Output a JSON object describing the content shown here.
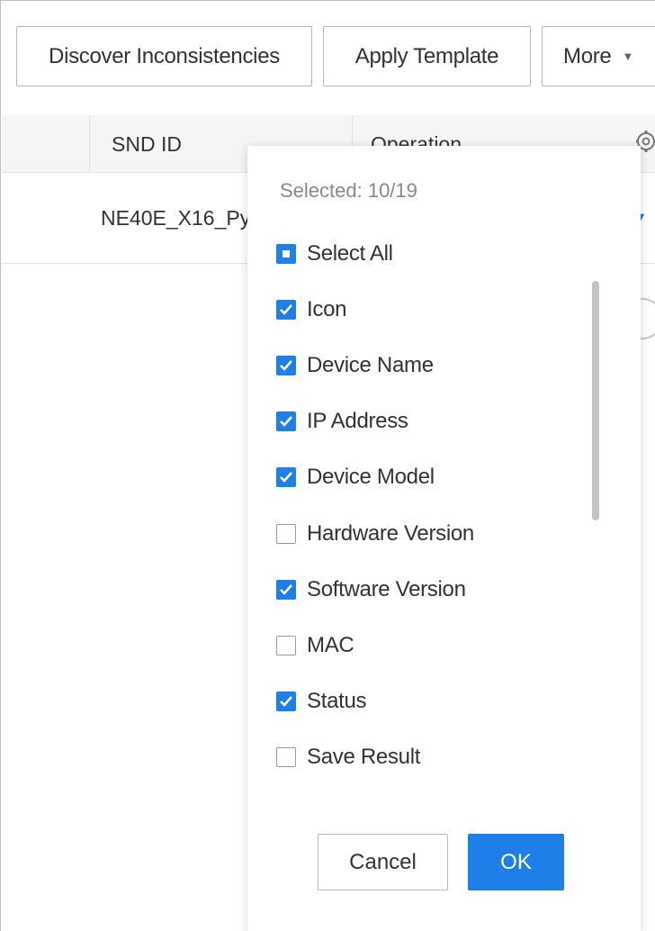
{
  "toolbar": {
    "discover_label": "Discover Inconsistencies",
    "apply_label": "Apply Template",
    "more_label": "More"
  },
  "table": {
    "columns": [
      "SND ID",
      "Operation"
    ],
    "rows": [
      {
        "snd_id": "NE40E_X16_Py"
      }
    ]
  },
  "column_picker": {
    "selected_text": "Selected: 10/19",
    "select_all_label": "Select All",
    "select_all_state": "partial",
    "options": [
      {
        "label": "Icon",
        "checked": true
      },
      {
        "label": "Device Name",
        "checked": true
      },
      {
        "label": "IP Address",
        "checked": true
      },
      {
        "label": "Device Model",
        "checked": true
      },
      {
        "label": "Hardware Version",
        "checked": false
      },
      {
        "label": "Software Version",
        "checked": true
      },
      {
        "label": "MAC",
        "checked": false
      },
      {
        "label": "Status",
        "checked": true
      },
      {
        "label": "Save Result",
        "checked": false
      }
    ],
    "cancel_label": "Cancel",
    "ok_label": "OK"
  },
  "colors": {
    "accent": "#1e7fe8",
    "header_bg": "#f5f5f5",
    "muted_text": "#8a8a8a"
  },
  "icons": [
    "caret-down-icon",
    "gear-icon",
    "checkmark-icon"
  ]
}
